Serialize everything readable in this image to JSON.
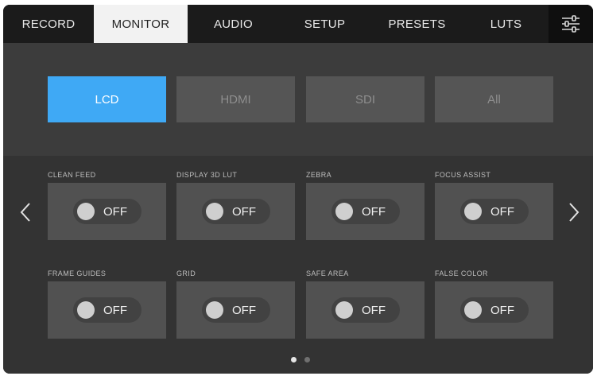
{
  "tabs": [
    {
      "label": "RECORD",
      "active": false
    },
    {
      "label": "MONITOR",
      "active": true
    },
    {
      "label": "AUDIO",
      "active": false
    },
    {
      "label": "SETUP",
      "active": false
    },
    {
      "label": "PRESETS",
      "active": false
    },
    {
      "label": "LUTS",
      "active": false
    }
  ],
  "settings_icon": "sliders-icon",
  "outputs": [
    {
      "label": "LCD",
      "active": true
    },
    {
      "label": "HDMI",
      "active": false
    },
    {
      "label": "SDI",
      "active": false
    },
    {
      "label": "All",
      "active": false
    }
  ],
  "options": [
    {
      "label": "CLEAN FEED",
      "state": "OFF"
    },
    {
      "label": "DISPLAY 3D LUT",
      "state": "OFF"
    },
    {
      "label": "ZEBRA",
      "state": "OFF"
    },
    {
      "label": "FOCUS ASSIST",
      "state": "OFF"
    },
    {
      "label": "FRAME GUIDES",
      "state": "OFF"
    },
    {
      "label": "GRID",
      "state": "OFF"
    },
    {
      "label": "SAFE AREA",
      "state": "OFF"
    },
    {
      "label": "FALSE COLOR",
      "state": "OFF"
    }
  ],
  "pagination": {
    "pages": 2,
    "current": 1
  },
  "colors": {
    "accent": "#3fa9f5",
    "tabbar": "#1b1b1b",
    "active_tab": "#f2f2f2"
  }
}
